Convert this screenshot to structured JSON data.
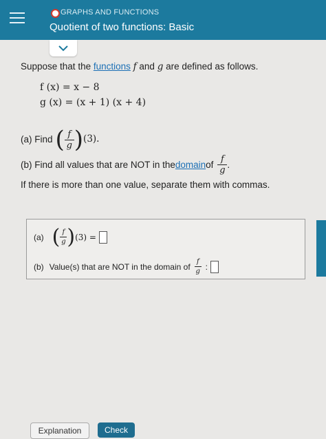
{
  "header": {
    "topic": "GRAPHS AND FUNCTIONS",
    "title": "Quotient of two functions: Basic"
  },
  "problem": {
    "intro_prefix": "Suppose that the ",
    "intro_link": "functions",
    "intro_f": "f",
    "intro_mid": " and ",
    "intro_g": "g",
    "intro_suffix": " are defined as follows.",
    "eq_f": "f (x) = x − 8",
    "eq_g": "g (x) = (x + 1) (x + 4)",
    "part_a_prefix": "(a) Find",
    "frac_num": "f",
    "frac_den": "g",
    "part_a_arg": "(3).",
    "part_b_prefix": "(b) Find all values that are NOT in the ",
    "part_b_link": "domain",
    "part_b_of": " of",
    "part_b_end": ".",
    "instruction": "If there is more than one value, separate them with commas."
  },
  "answer": {
    "a_label": "(a)",
    "a_arg": "(3) =",
    "b_label": "(b)",
    "b_text": "Value(s) that are NOT in the domain of",
    "b_colon": ":"
  },
  "buttons": {
    "explanation": "Explanation",
    "check": "Check"
  },
  "colors": {
    "header": "#1c7a9e",
    "link": "#1b6fb5",
    "status": "#d23b2e"
  }
}
